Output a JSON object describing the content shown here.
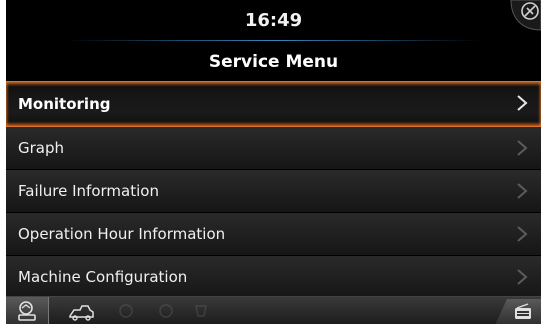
{
  "status_bar": {
    "time": "16:49"
  },
  "screen": {
    "title": "Service Menu"
  },
  "menu": {
    "items": [
      {
        "label": "Monitoring"
      },
      {
        "label": "Graph"
      },
      {
        "label": "Failure Information"
      },
      {
        "label": "Operation Hour Information"
      },
      {
        "label": "Machine Configuration"
      }
    ],
    "selected_index": 0
  },
  "colors": {
    "selection_glow": "#e0702a",
    "accent_line": "#3c96d2",
    "background": "#000000"
  },
  "icons": {
    "top_right": "settings-wrench-icon",
    "bottom_left": "machine-status-icon",
    "bottom_second": "engine-icon",
    "bottom_right": "radio-icon"
  }
}
